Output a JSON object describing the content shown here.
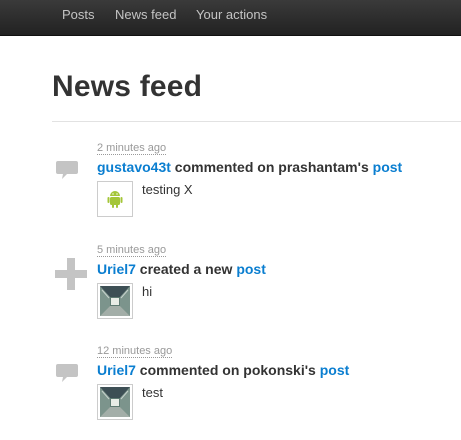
{
  "nav": {
    "items": [
      {
        "label": "Posts"
      },
      {
        "label": "News feed"
      },
      {
        "label": "Your actions"
      }
    ]
  },
  "page": {
    "title": "News feed"
  },
  "feed": [
    {
      "icon": "comment-icon",
      "time": "2 minutes ago",
      "user": "gustavo43t",
      "action": " commented on prashantam's ",
      "link": "post",
      "thumb": "android-icon",
      "text": "testing X"
    },
    {
      "icon": "plus-icon",
      "time": "5 minutes ago",
      "user": "Uriel7",
      "action": " created a new ",
      "link": "post",
      "thumb": "corridor-photo",
      "text": "hi"
    },
    {
      "icon": "comment-icon",
      "time": "12 minutes ago",
      "user": "Uriel7",
      "action": " commented on pokonski's ",
      "link": "post",
      "thumb": "corridor-photo",
      "text": "test"
    }
  ],
  "colors": {
    "navbar": "#2b2b2b",
    "link": "#0a7ed0",
    "icon_gray": "#c4c4c4",
    "android_green": "#a4c639"
  }
}
